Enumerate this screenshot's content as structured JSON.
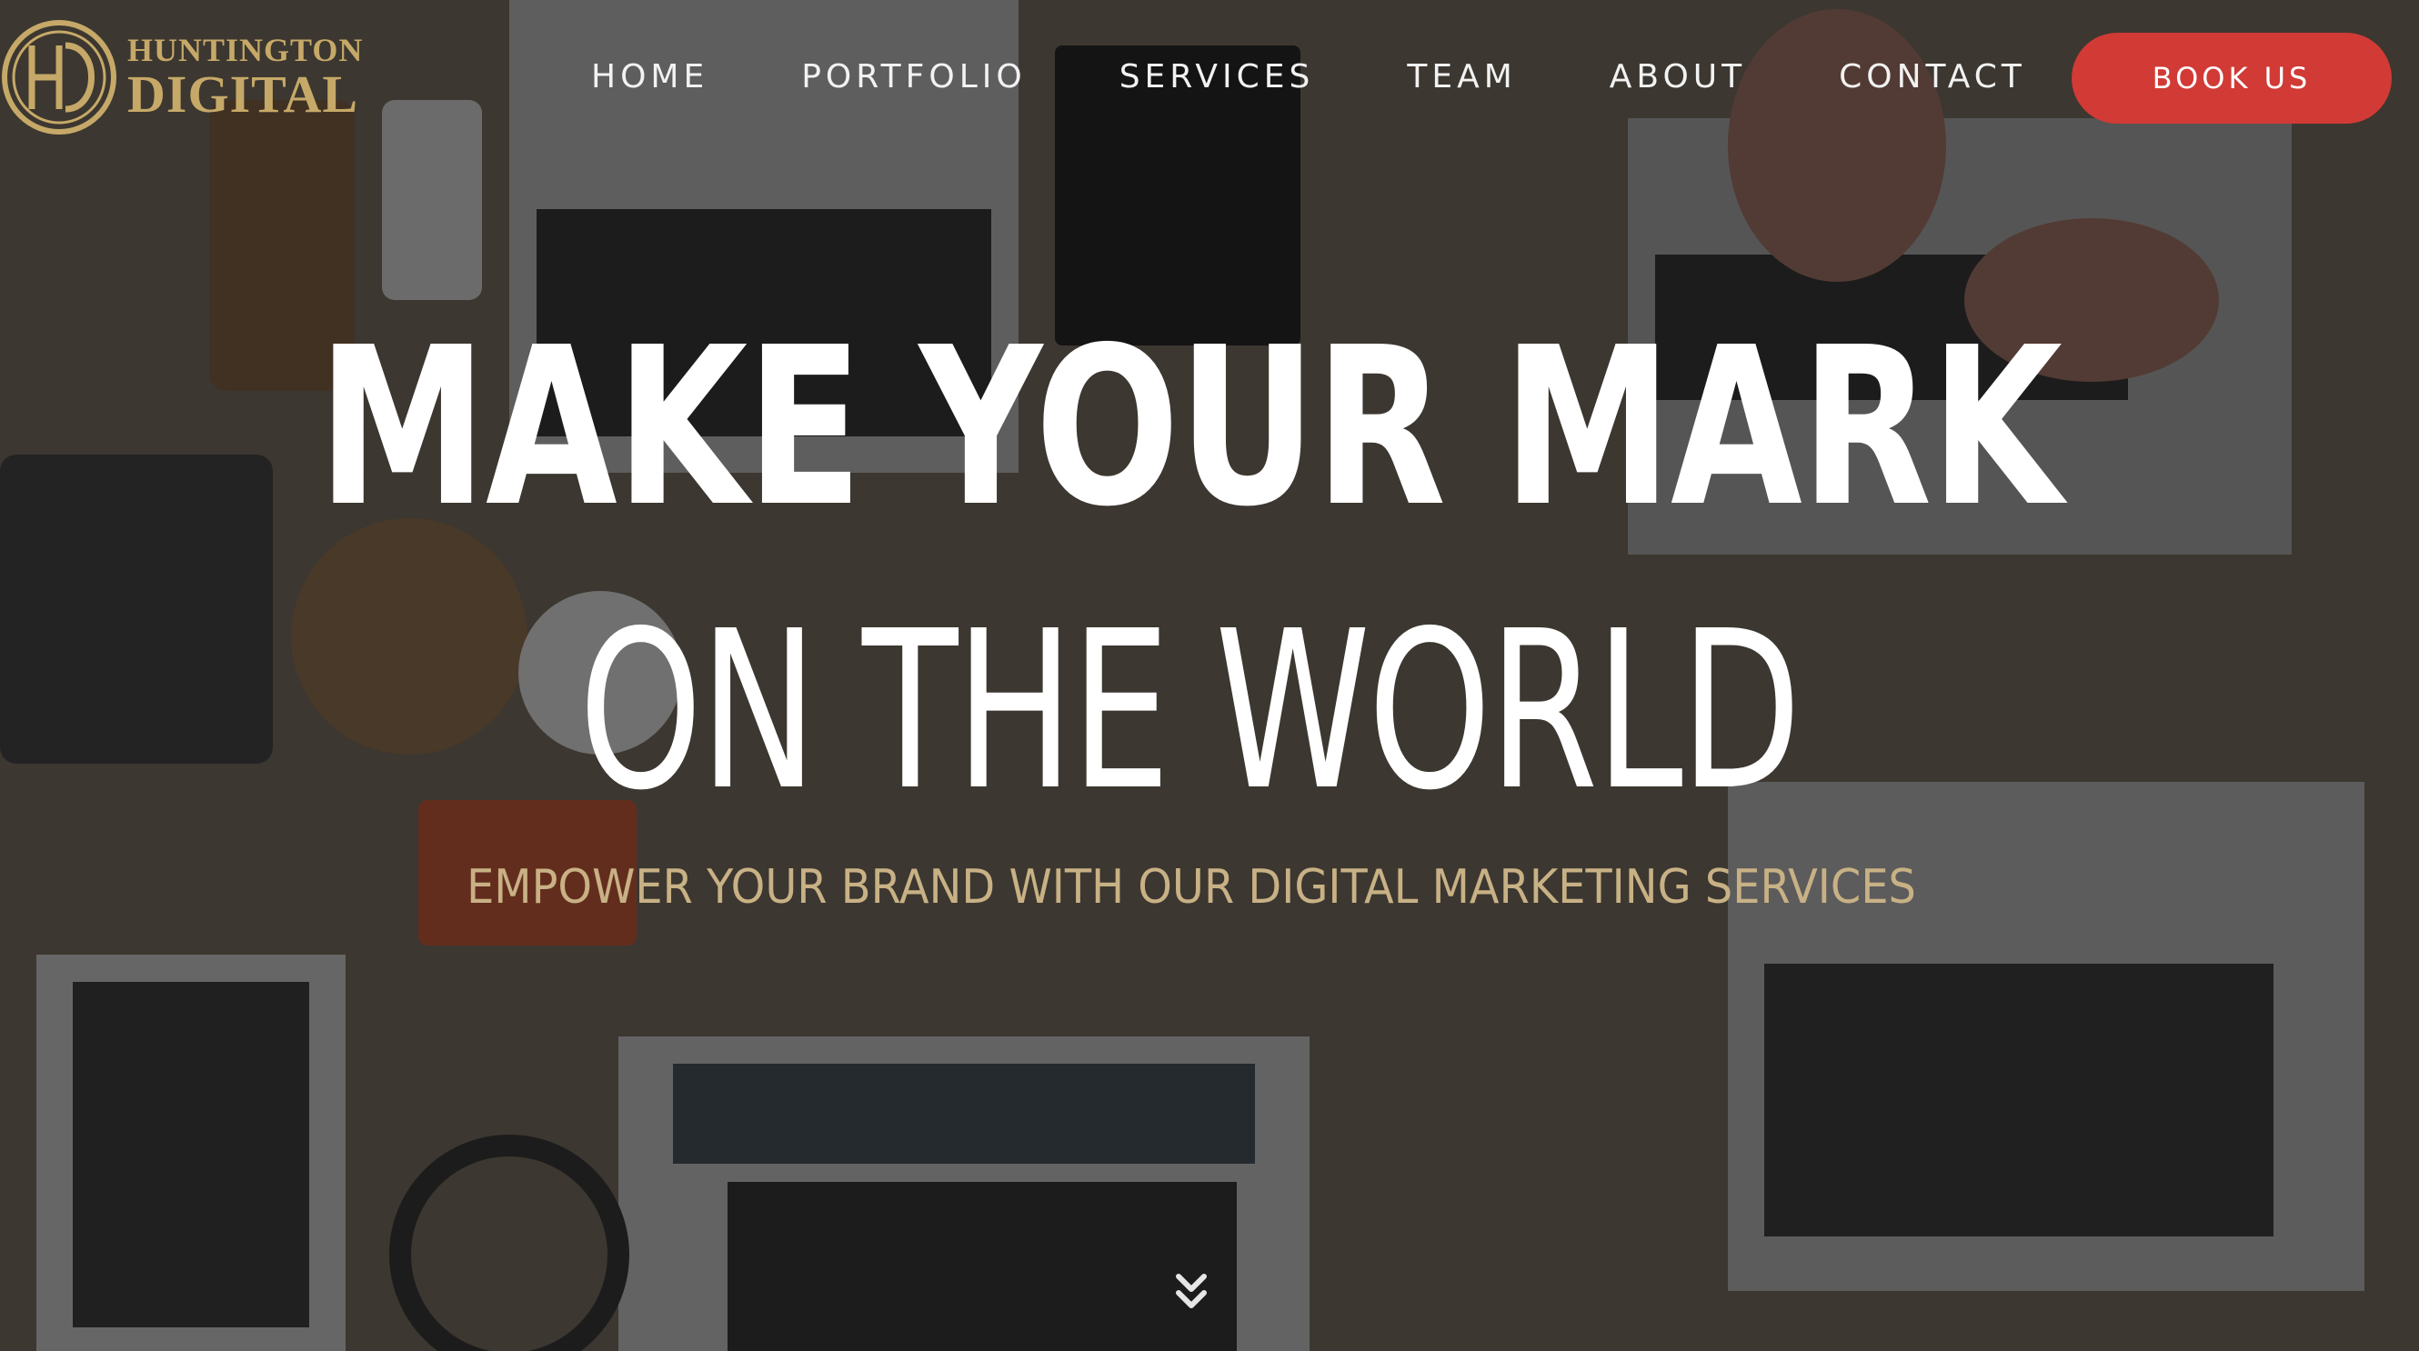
{
  "brand": {
    "logo_line1": "HUNTINGTON",
    "logo_line2": "DIGITAL",
    "logo_color": "#c6a968"
  },
  "nav": {
    "items": [
      {
        "label": "HOME"
      },
      {
        "label": "PORTFOLIO"
      },
      {
        "label": "SERVICES"
      },
      {
        "label": "TEAM"
      },
      {
        "label": "ABOUT"
      },
      {
        "label": "CONTACT"
      }
    ],
    "cta_label": "BOOK US",
    "cta_color": "#d13a35"
  },
  "hero": {
    "title_line1": "MAKE YOUR MARK",
    "title_line2": "ON THE WORLD",
    "subtitle": "EMPOWER YOUR BRAND WITH OUR DIGITAL MARKETING SERVICES",
    "subtitle_color": "#c8b185",
    "scroll_icon": "double-chevron-down-icon"
  }
}
